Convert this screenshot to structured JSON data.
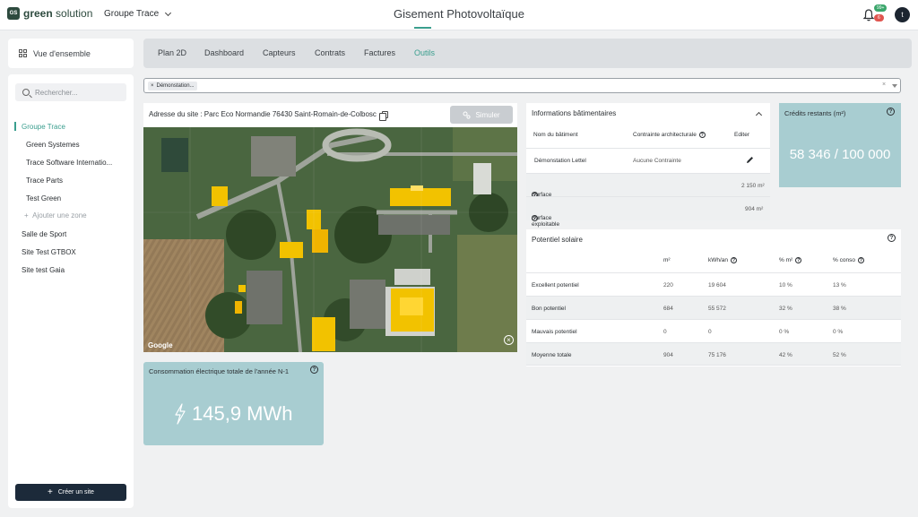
{
  "brand": {
    "mark": "GS",
    "name_bold": "green",
    "name_rest": " solution"
  },
  "header": {
    "site": "Groupe Trace",
    "title": "Gisement Photovoltaïque",
    "badge_green": "99+",
    "badge_red": "6",
    "avatar": "t"
  },
  "sidebar": {
    "overview": "Vue d'ensemble",
    "search_placeholder": "Rechercher...",
    "items": [
      {
        "label": "Groupe Trace"
      },
      {
        "label": "Green Systemes"
      },
      {
        "label": "Trace Software Internatio..."
      },
      {
        "label": "Trace Parts"
      },
      {
        "label": "Test Green"
      },
      {
        "label": "Ajouter une zone"
      },
      {
        "label": "Salle de Sport"
      },
      {
        "label": "Site Test GTBOX"
      },
      {
        "label": "Site test Gaia"
      }
    ],
    "create_label": "Créer un site"
  },
  "tabs": [
    {
      "label": "Plan 2D"
    },
    {
      "label": "Dashboard"
    },
    {
      "label": "Capteurs"
    },
    {
      "label": "Contrats"
    },
    {
      "label": "Factures"
    },
    {
      "label": "Outils"
    }
  ],
  "filter": {
    "chip": "Démonstation..."
  },
  "map": {
    "address": "Adresse du site : Parc Eco Normandie 76430 Saint-Romain-de-Colbosc",
    "simulate_label": "Simuler",
    "attribution": "Google"
  },
  "consumption": {
    "title": "Consommation électrique totale de l'année N-1",
    "value": "145,9 MWh"
  },
  "building": {
    "title": "Informations bâtimentaires",
    "headers": {
      "name": "Nom du bâtiment",
      "constraint": "Contrainte architecturale",
      "edit": "Editer"
    },
    "row": {
      "name": "Démonstation Lettel",
      "constraint": "Aucune Contrainte"
    },
    "surface_total_label": "Surface totale",
    "surface_total_value": "2 150 m²",
    "surface_exp_label": "Surface exploitable",
    "surface_exp_value": "904 m²"
  },
  "credits": {
    "title": "Crédits restants (m²)",
    "value": "58 346 / 100 000"
  },
  "solar": {
    "title": "Potentiel solaire",
    "headers": {
      "m2": "m²",
      "kwh": "kWh/an",
      "pct_m2": "% m²",
      "pct_conso": "% conso"
    },
    "rows": [
      {
        "label": "Excellent potentiel",
        "m2": "220",
        "kwh": "19 604",
        "pct_m2": "10 %",
        "pct_conso": "13 %"
      },
      {
        "label": "Bon potentiel",
        "m2": "684",
        "kwh": "55 572",
        "pct_m2": "32 %",
        "pct_conso": "38 %"
      },
      {
        "label": "Mauvais potentiel",
        "m2": "0",
        "kwh": "0",
        "pct_m2": "0 %",
        "pct_conso": "0 %"
      },
      {
        "label": "Moyenne totale",
        "m2": "904",
        "kwh": "75 176",
        "pct_m2": "42 %",
        "pct_conso": "52 %"
      }
    ]
  },
  "colors": {
    "accent": "#3a9e8e",
    "card_teal": "#a8cdd1",
    "dark": "#1c2a3a",
    "heat": "#f2c200"
  }
}
